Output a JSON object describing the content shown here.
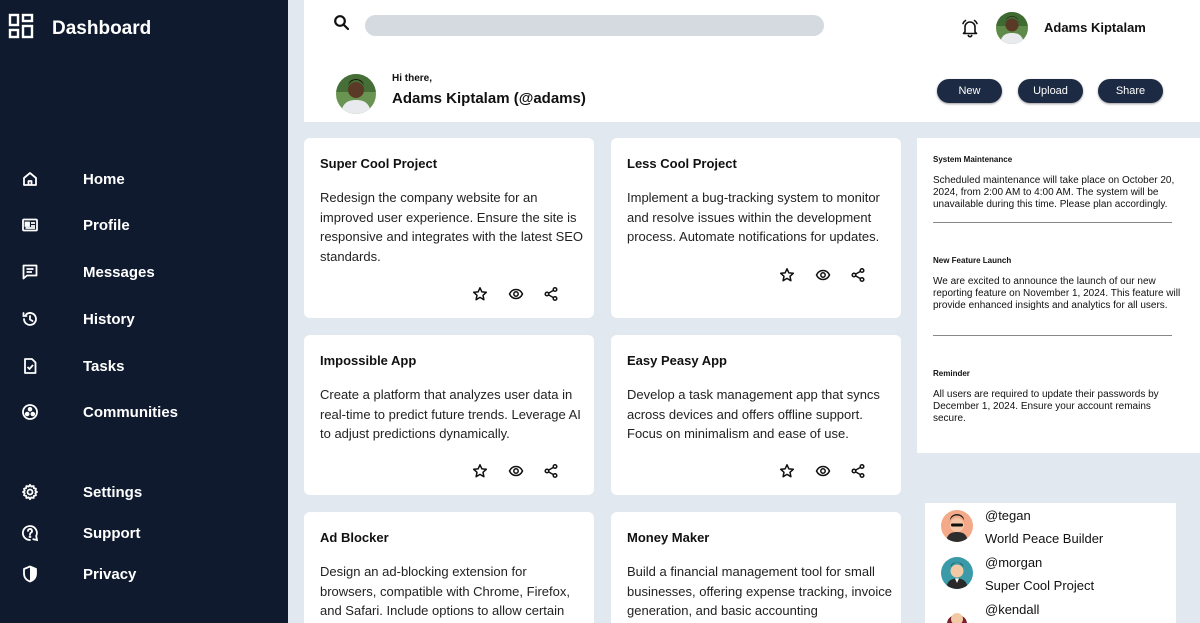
{
  "app": {
    "title": "Dashboard"
  },
  "sidebar": {
    "items": [
      {
        "label": "Home",
        "icon": "home-icon"
      },
      {
        "label": "Profile",
        "icon": "id-card-icon"
      },
      {
        "label": "Messages",
        "icon": "message-icon"
      },
      {
        "label": "History",
        "icon": "history-icon"
      },
      {
        "label": "Tasks",
        "icon": "task-file-icon"
      },
      {
        "label": "Communities",
        "icon": "communities-icon"
      }
    ],
    "bottom_items": [
      {
        "label": "Settings",
        "icon": "gear-icon"
      },
      {
        "label": "Support",
        "icon": "help-icon"
      },
      {
        "label": "Privacy",
        "icon": "shield-icon"
      }
    ]
  },
  "header": {
    "search": {
      "placeholder": "",
      "value": ""
    },
    "user_name": "Adams Kiptalam",
    "greeting": "Hi there,",
    "display_name": "Adams Kiptalam (@adams)",
    "buttons": {
      "new": "New",
      "upload": "Upload",
      "share": "Share"
    }
  },
  "projects": [
    {
      "title": "Super Cool Project",
      "description": "Redesign the company website for an improved user experience. Ensure the site is responsive and integrates with the latest SEO standards."
    },
    {
      "title": "Less Cool Project",
      "description": "Implement a bug-tracking system to monitor and resolve issues within the development process. Automate notifications for updates."
    },
    {
      "title": "Impossible App",
      "description": "Create a platform that analyzes user data in real-time to predict future trends. Leverage AI to adjust predictions dynamically."
    },
    {
      "title": "Easy Peasy App",
      "description": "Develop a task management app that syncs across devices and offers offline support. Focus on minimalism and ease of use."
    },
    {
      "title": "Ad Blocker",
      "description": "Design an ad-blocking extension for browsers, compatible with Chrome, Firefox, and Safari. Include options to allow certain"
    },
    {
      "title": "Money Maker",
      "description": "Build a financial management tool for small businesses, offering expense tracking, invoice generation, and basic accounting"
    }
  ],
  "announcements": [
    {
      "title": "System Maintenance",
      "text": "Scheduled maintenance will take place on October 20, 2024, from 2:00 AM to 4:00 AM. The system will be unavailable during this time. Please plan accordingly."
    },
    {
      "title": "New Feature Launch",
      "text": "We are excited to announce the launch of our new reporting feature on November 1, 2024. This feature will provide enhanced insights and analytics for all users."
    },
    {
      "title": "Reminder",
      "text": "All users are required to update their passwords by December 1, 2024. Ensure your account remains secure."
    }
  ],
  "people": [
    {
      "handle": "@tegan",
      "project": "World Peace Builder"
    },
    {
      "handle": "@morgan",
      "project": "Super Cool Project"
    },
    {
      "handle": "@kendall",
      "project": ""
    }
  ],
  "colors": {
    "sidebar_bg": "#0f1a2e",
    "button_bg": "#1c2a43",
    "page_bg": "#e2e8f0"
  }
}
